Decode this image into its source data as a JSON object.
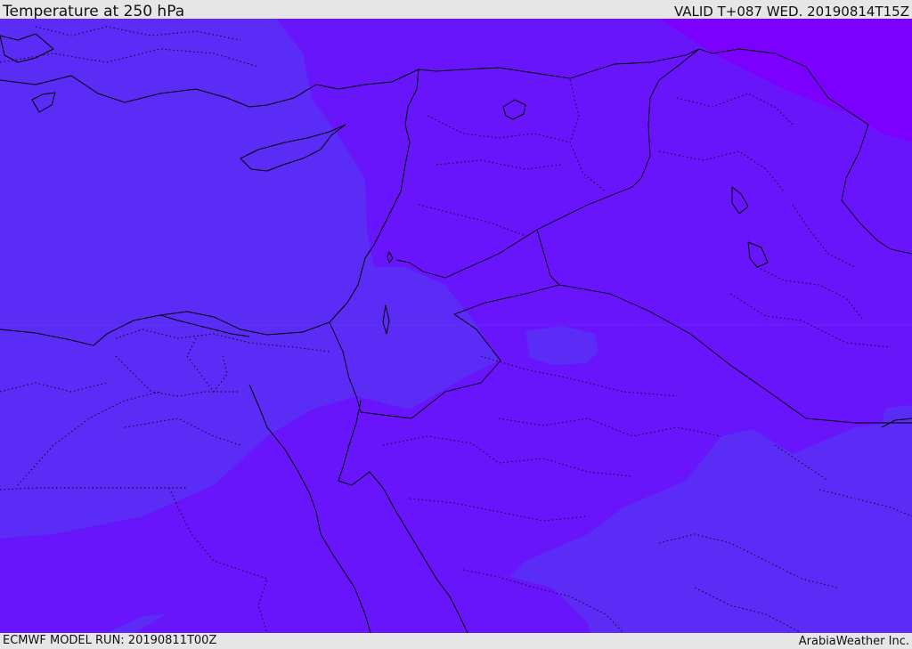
{
  "header": {
    "title": "Temperature at 250 hPa",
    "valid_time": "VALID T+087 WED. 20190814T15Z"
  },
  "footer": {
    "model_run": "ECMWF MODEL RUN: 20190811T00Z",
    "credit": "ArabiaWeather Inc."
  },
  "colors": {
    "band_warm": "#5a2cf6",
    "band_mid": "#6815fb",
    "band_cold": "#7c00ff",
    "coastline": "#000000",
    "border": "#000000"
  }
}
